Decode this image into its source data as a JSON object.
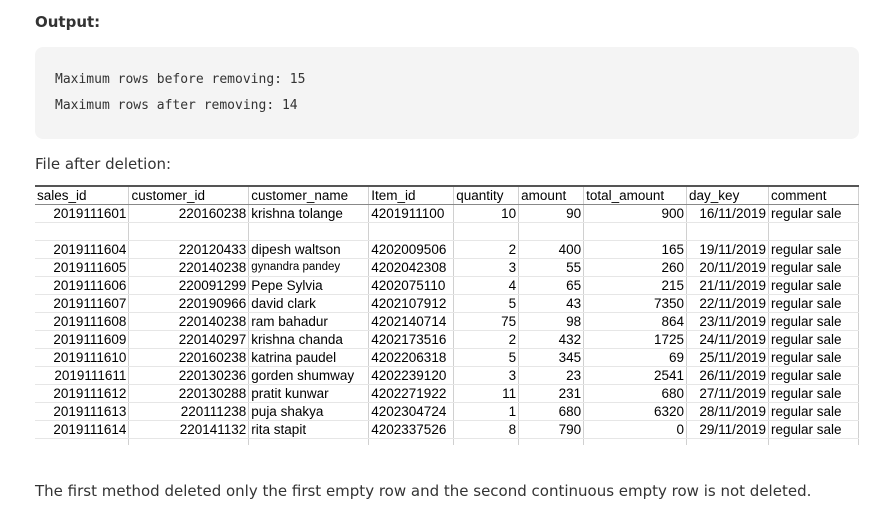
{
  "heading": "Output:",
  "code": {
    "line1": "Maximum rows before removing: 15",
    "line2": "Maximum rows after removing: 14"
  },
  "subtitle": "File after deletion:",
  "table": {
    "headers": [
      "sales_id",
      "customer_id",
      "customer_name",
      "Item_id",
      "quantity",
      "amount",
      "total_amount",
      "day_key",
      "comment"
    ],
    "rows": [
      [
        "2019111601",
        "220160238",
        "krishna tolange",
        "4201911100",
        "10",
        "90",
        "900",
        "16/11/2019",
        "regular sale"
      ],
      [
        "",
        "",
        "",
        "",
        "",
        "",
        "",
        "",
        ""
      ],
      [
        "2019111604",
        "220120433",
        "dipesh waltson",
        "4202009506",
        "2",
        "400",
        "165",
        "19/11/2019",
        "regular sale"
      ],
      [
        "2019111605",
        "220140238",
        "gynandra pandey",
        "4202042308",
        "3",
        "55",
        "260",
        "20/11/2019",
        "regular sale"
      ],
      [
        "2019111606",
        "220091299",
        "Pepe Sylvia",
        "4202075110",
        "4",
        "65",
        "215",
        "21/11/2019",
        "regular sale"
      ],
      [
        "2019111607",
        "220190966",
        "david clark",
        "4202107912",
        "5",
        "43",
        "7350",
        "22/11/2019",
        "regular sale"
      ],
      [
        "2019111608",
        "220140238",
        "ram bahadur",
        "4202140714",
        "75",
        "98",
        "864",
        "23/11/2019",
        "regular sale"
      ],
      [
        "2019111609",
        "220140297",
        "krishna chanda",
        "4202173516",
        "2",
        "432",
        "1725",
        "24/11/2019",
        "regular sale"
      ],
      [
        "2019111610",
        "220160238",
        "katrina paudel",
        "4202206318",
        "5",
        "345",
        "69",
        "25/11/2019",
        "regular sale"
      ],
      [
        "2019111611",
        "220130236",
        "gorden shumway",
        "4202239120",
        "3",
        "23",
        "2541",
        "26/11/2019",
        "regular sale"
      ],
      [
        "2019111612",
        "220130288",
        "pratit kunwar",
        "4202271922",
        "11",
        "231",
        "680",
        "27/11/2019",
        "regular sale"
      ],
      [
        "2019111613",
        "220111238",
        "puja shakya",
        "4202304724",
        "1",
        "680",
        "6320",
        "28/11/2019",
        "regular sale"
      ],
      [
        "2019111614",
        "220141132",
        "rita stapit",
        "4202337526",
        "8",
        "790",
        "0",
        "29/11/2019",
        "regular sale"
      ],
      [
        "",
        "",
        "",
        "",
        "",
        "",
        "",
        "",
        ""
      ],
      [
        "",
        "",
        "",
        "",
        "",
        "",
        "",
        "",
        ""
      ]
    ]
  },
  "footer": "The first method deleted only the first empty row and the second continuous empty row is not deleted."
}
